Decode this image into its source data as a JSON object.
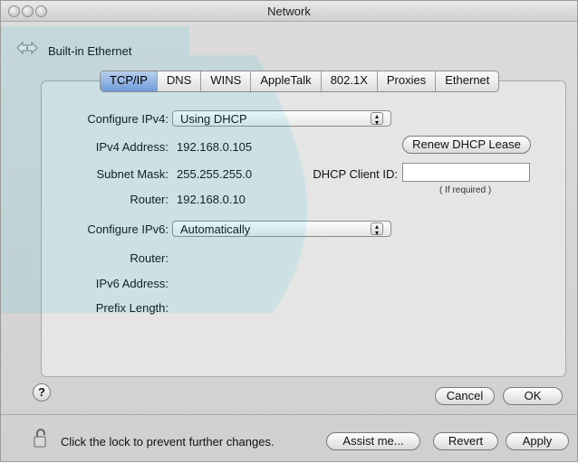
{
  "window": {
    "title": "Network"
  },
  "toolbar": {
    "location": "Built-in Ethernet",
    "nav_icon": "network-arrows-icon"
  },
  "tabs": [
    "TCP/IP",
    "DNS",
    "WINS",
    "AppleTalk",
    "802.1X",
    "Proxies",
    "Ethernet"
  ],
  "active_tab": "TCP/IP",
  "ipv4": {
    "configure_label": "Configure IPv4:",
    "configure_value": "Using DHCP",
    "address_label": "IPv4 Address:",
    "address_value": "192.168.0.105",
    "subnet_label": "Subnet Mask:",
    "subnet_value": "255.255.255.0",
    "router_label": "Router:",
    "router_value": "192.168.0.10",
    "renew_button": "Renew DHCP Lease",
    "client_id_label": "DHCP Client ID:",
    "client_id_value": "",
    "client_id_hint": "( If required )"
  },
  "ipv6": {
    "configure_label": "Configure IPv6:",
    "configure_value": "Automatically",
    "router_label": "Router:",
    "address_label": "IPv6 Address:",
    "prefix_label": "Prefix Length:"
  },
  "footer": {
    "help": "?",
    "cancel": "Cancel",
    "ok": "OK",
    "lock_text": "Click the lock to prevent further changes.",
    "assist": "Assist me...",
    "revert": "Revert",
    "apply": "Apply"
  },
  "colors": {
    "overlay_accent": "#00b8d8",
    "active_tab": "#7aa6de"
  }
}
